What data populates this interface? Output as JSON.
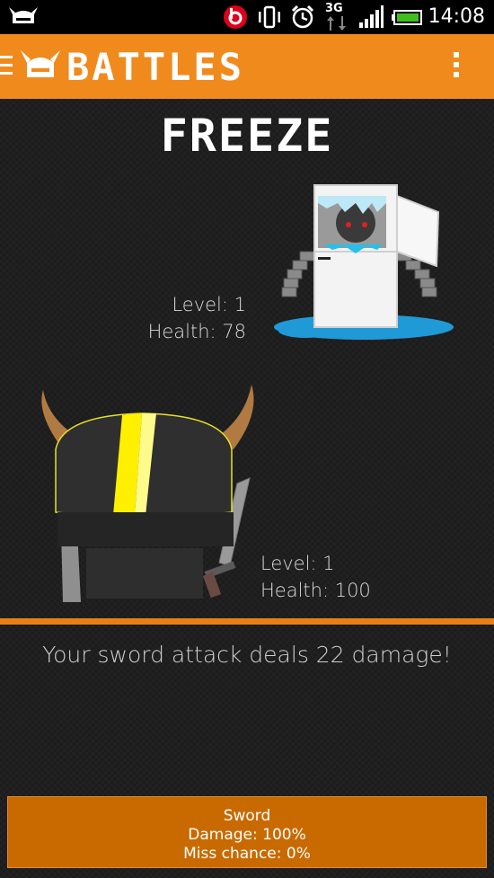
{
  "status_bar": {
    "time": "14:08",
    "network": "3G",
    "icons": [
      "app-notification-icon",
      "beats-audio-icon",
      "vibrate-icon",
      "alarm-icon",
      "3g-data-icon",
      "signal-icon",
      "battery-icon"
    ]
  },
  "action_bar": {
    "title": "BATTLES",
    "icons": [
      "hamburger-icon",
      "viking-helmet-logo",
      "overflow-menu-icon"
    ],
    "color": "#f08a1c"
  },
  "enemy": {
    "name": "FREEZE",
    "level_text": "Level: 1",
    "health_text": "Health: 78"
  },
  "player": {
    "level_text": "Level: 1",
    "health_text": "Health: 100"
  },
  "log": {
    "message": "Your sword attack deals 22 damage!"
  },
  "attack_button": {
    "name": "Sword",
    "damage": "Damage: 100%",
    "miss": "Miss chance: 0%",
    "color": "#c96a00"
  }
}
